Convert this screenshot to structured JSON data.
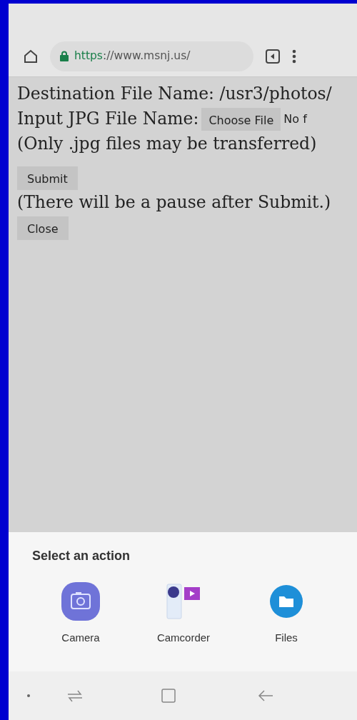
{
  "browser": {
    "url_scheme": "https",
    "url_rest": "://www.msnj.us/",
    "secure": true
  },
  "page": {
    "destination_line": "Destination File Name: /usr3/photos/",
    "input_label": "Input JPG File Name:",
    "choose_button": "Choose File",
    "file_status": "No f",
    "note": "(Only .jpg files may be transferred)",
    "submit_button": "Submit",
    "pause_note": "(There will be a pause after Submit.)",
    "close_button": "Close"
  },
  "action_sheet": {
    "title": "Select an action",
    "actions": [
      {
        "kind": "camera",
        "label": "Camera"
      },
      {
        "kind": "camcorder",
        "label": "Camcorder"
      },
      {
        "kind": "files",
        "label": "Files"
      }
    ]
  }
}
